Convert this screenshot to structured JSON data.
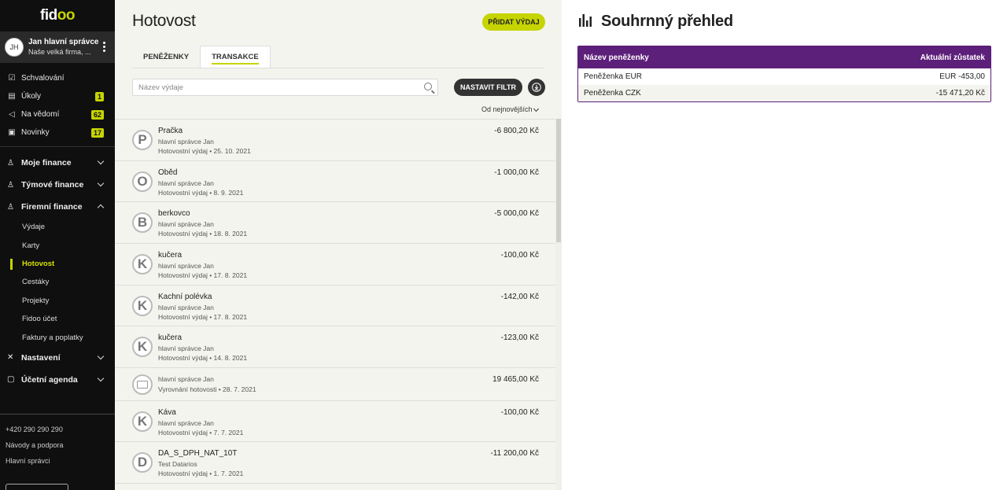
{
  "app": {
    "logo": "fidoo",
    "logo_main": "fid",
    "logo_accent": "oo"
  },
  "user": {
    "initials": "JH",
    "name": "Jan hlavní správce",
    "company": "Naše velká firma, ..."
  },
  "nav_top": [
    {
      "label": "Schvalování",
      "icon": "check-icon",
      "badge": ""
    },
    {
      "label": "Úkoly",
      "icon": "clipboard-icon",
      "badge": "1"
    },
    {
      "label": "Na vědomí",
      "icon": "megaphone-icon",
      "badge": "62"
    },
    {
      "label": "Novinky",
      "icon": "news-icon",
      "badge": "17"
    }
  ],
  "sections": {
    "moje_finance": "Moje finance",
    "tymove_finance": "Týmové finance",
    "firemni_finance": "Firemní finance",
    "nastaveni": "Nastavení",
    "ucetni_agenda": "Účetní agenda"
  },
  "firemni_items": [
    "Výdaje",
    "Karty",
    "Hotovost",
    "Cestáky",
    "Projekty",
    "Fidoo účet",
    "Faktury a poplatky"
  ],
  "active_item": "Hotovost",
  "footer": {
    "phone": "+420 290 290 290",
    "help": "Návody a podpora",
    "admins": "Hlavní správci"
  },
  "main": {
    "title": "Hotovost",
    "add_button": "PŘIDAT VÝDAJ",
    "tabs": [
      "PENĚŽENKY",
      "TRANSAKCE"
    ],
    "active_tab": "TRANSAKCE",
    "search_placeholder": "Název výdaje",
    "filter_button": "NASTAVIT FILTR",
    "sort_label": "Od nejnovějších"
  },
  "transactions": [
    {
      "initial": "P",
      "name": "Pračka",
      "who": "hlavní správce Jan",
      "meta": "Hotovostní výdaj • 25. 10. 2021",
      "amount": "-6 800,20 Kč"
    },
    {
      "initial": "O",
      "name": "Oběd",
      "who": "hlavní správce Jan",
      "meta": "Hotovostní výdaj • 8. 9. 2021",
      "amount": "-1 000,00 Kč"
    },
    {
      "initial": "B",
      "name": "berkovco",
      "who": "hlavní správce Jan",
      "meta": "Hotovostní výdaj • 18. 8. 2021",
      "amount": "-5 000,00 Kč"
    },
    {
      "initial": "K",
      "name": "kučera",
      "who": "hlavní správce Jan",
      "meta": "Hotovostní výdaj • 17. 8. 2021",
      "amount": "-100,00 Kč"
    },
    {
      "initial": "K",
      "name": "Kachní polévka",
      "who": "hlavní správce Jan",
      "meta": "Hotovostní výdaj • 17. 8. 2021",
      "amount": "-142,00 Kč"
    },
    {
      "initial": "K",
      "name": "kučera",
      "who": "hlavní správce Jan",
      "meta": "Hotovostní výdaj • 14. 8. 2021",
      "amount": "-123,00 Kč"
    },
    {
      "initial": "",
      "name": "",
      "who": "hlavní správce Jan",
      "meta": "Vyrovnání hotovosti • 28. 7. 2021",
      "amount": "19 465,00 Kč",
      "cash": true
    },
    {
      "initial": "K",
      "name": "Káva",
      "who": "hlavní správce Jan",
      "meta": "Hotovostní výdaj • 7. 7. 2021",
      "amount": "-100,00 Kč"
    },
    {
      "initial": "D",
      "name": "DA_S_DPH_NAT_10T",
      "who": "Test Datarios",
      "meta": "Hotovostní výdaj • 1. 7. 2021",
      "amount": "-11 200,00 Kč"
    }
  ],
  "summary": {
    "title": "Souhrnný přehled",
    "col_name": "Název peněženky",
    "col_balance": "Aktuální zůstatek",
    "rows": [
      {
        "name": "Peněženka EUR",
        "balance": "EUR -453,00"
      },
      {
        "name": "Peněženka CZK",
        "balance": "-15 471,20 Kč"
      }
    ]
  },
  "colors": {
    "accent": "#c6d400",
    "header_purple": "#5c1f7a",
    "sidebar_bg": "#0f0f0f"
  }
}
